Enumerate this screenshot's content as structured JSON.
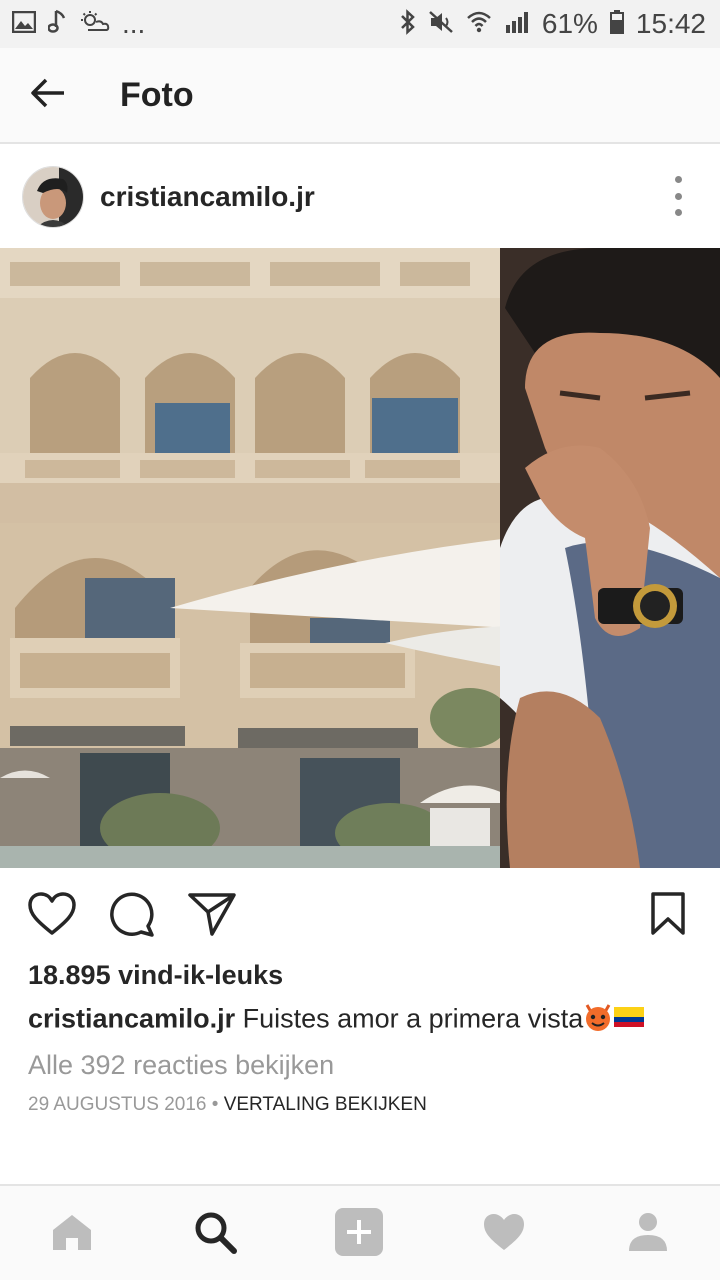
{
  "status_bar": {
    "dots": "...",
    "battery": "61%",
    "time": "15:42",
    "icons": [
      "image-icon",
      "music-note-icon",
      "weather-icon",
      "bluetooth-icon",
      "mute-icon",
      "wifi-icon",
      "signal-icon",
      "battery-icon"
    ]
  },
  "app_bar": {
    "title": "Foto",
    "back_icon": "arrow-left-icon"
  },
  "post": {
    "username": "cristiancamilo.jr",
    "likes": "18.895 vind-ik-leuks",
    "caption_user": "cristiancamilo.jr",
    "caption_text": "Fuistes amor a primera vista",
    "caption_emojis": [
      "devil-face-emoji",
      "colombia-flag-emoji"
    ],
    "comments_link": "Alle 392 reacties bekijken",
    "date": "29 AUGUSTUS 2016",
    "separator": " • ",
    "translate": "VERTALING BEKIJKEN",
    "actions": [
      "heart-icon",
      "comment-icon",
      "share-icon",
      "bookmark-icon"
    ]
  },
  "bottom_nav": {
    "items": [
      "home-icon",
      "search-icon",
      "add-icon",
      "activity-heart-icon",
      "profile-icon"
    ],
    "active": "search-icon"
  },
  "colors": {
    "text": "#262626",
    "secondary": "#999999",
    "nav_inactive": "#bdbdbd",
    "nav_active": "#262626"
  }
}
